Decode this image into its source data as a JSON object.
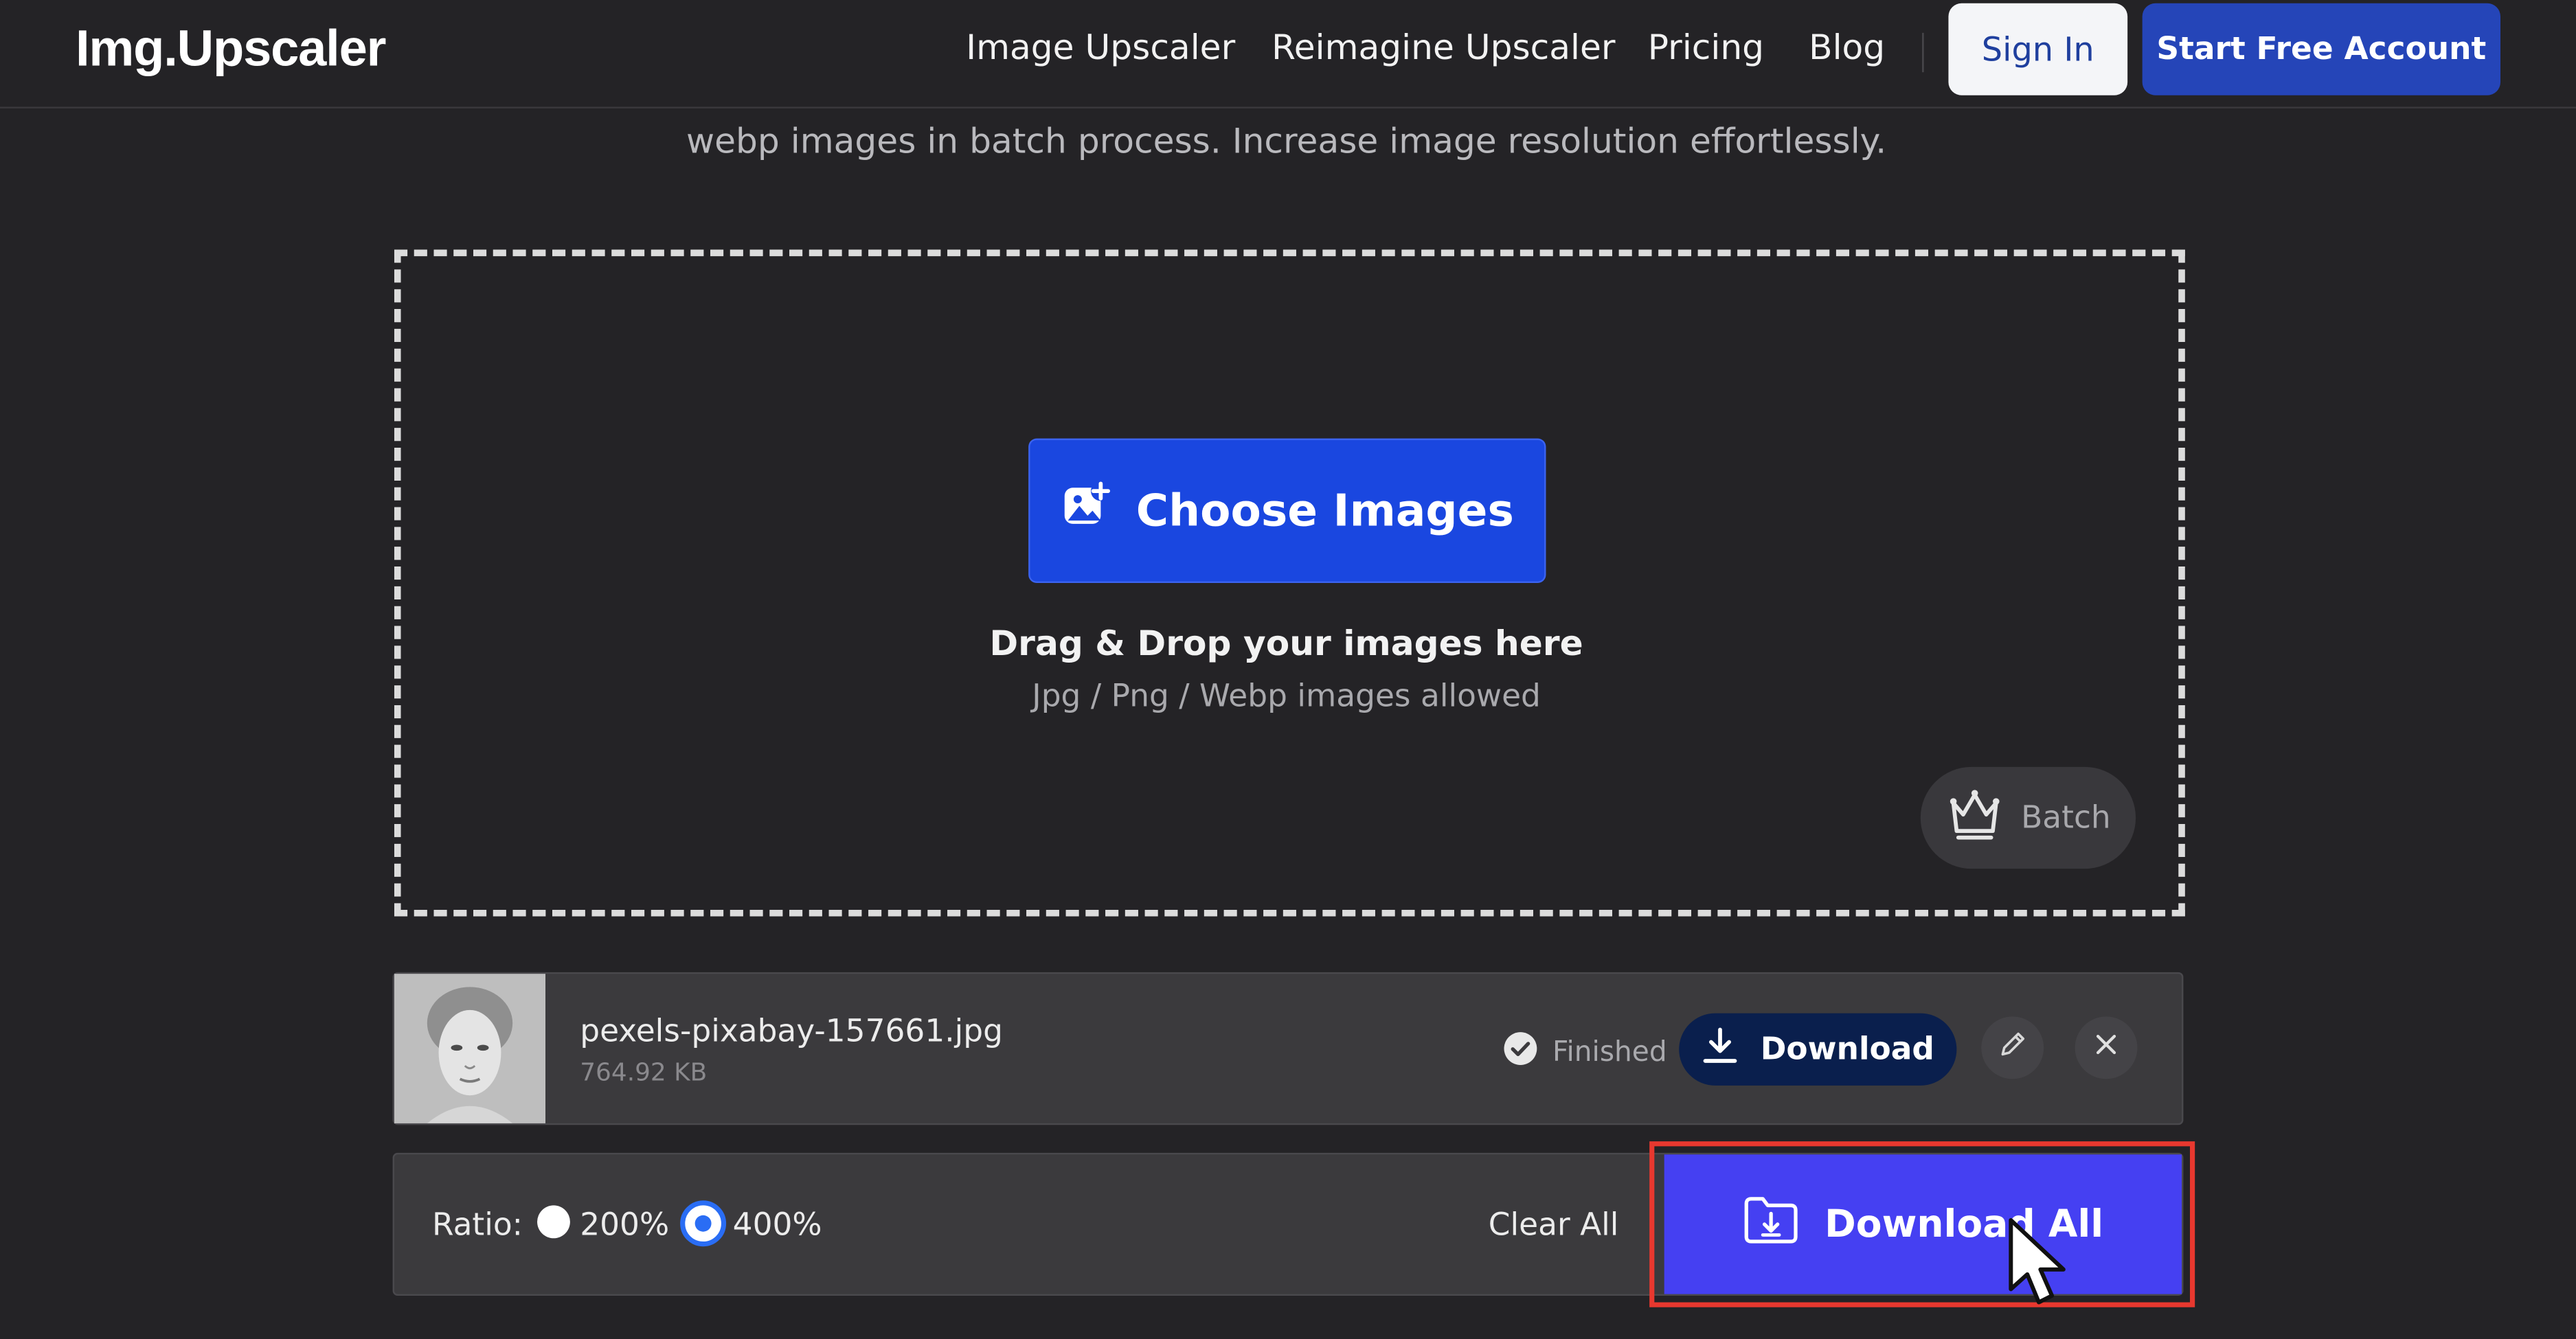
{
  "header": {
    "logo": "Img.Upscaler",
    "nav": [
      "Image Upscaler",
      "Reimagine Upscaler",
      "Pricing",
      "Blog"
    ],
    "sign_in_label": "Sign In",
    "start_label": "Start Free Account"
  },
  "hero": {
    "intro_text": "webp images in batch process. Increase image resolution effortlessly."
  },
  "dropzone": {
    "choose_label": "Choose Images",
    "drag_title": "Drag & Drop your images here",
    "drag_subtitle": "Jpg / Png / Webp images allowed",
    "batch_label": "Batch",
    "choose_icon": "image-add-icon",
    "batch_icon": "crown-icon"
  },
  "file": {
    "name": "pexels-pixabay-157661.jpg",
    "size": "764.92 KB",
    "status": "Finished",
    "download_label": "Download",
    "status_icon": "check-circle-icon",
    "download_icon": "download-icon",
    "edit_icon": "pencil-icon",
    "remove_icon": "close-icon"
  },
  "controls": {
    "ratio_label": "Ratio:",
    "options": [
      "200%",
      "400%"
    ],
    "selected": "400%",
    "clear_all_label": "Clear All",
    "download_all_label": "Download All",
    "download_all_icon": "folder-download-icon"
  },
  "colors": {
    "background": "#242326",
    "primary_button": "#1a47e0",
    "download_all_button": "#4540f2",
    "highlight_border": "#e8382f",
    "radio_selected": "#2a6df4"
  }
}
